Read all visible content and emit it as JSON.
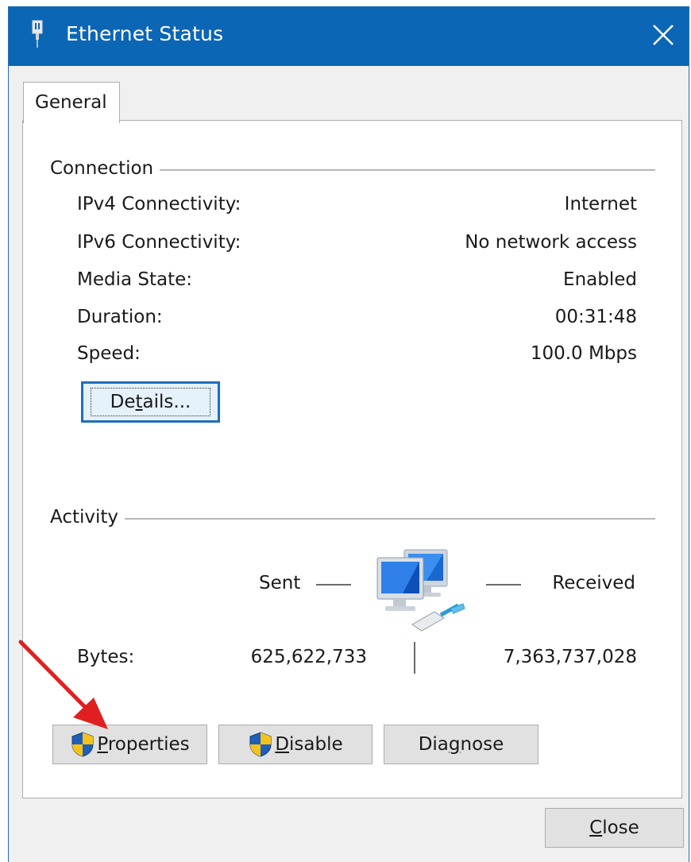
{
  "window": {
    "title": "Ethernet Status",
    "close_symbol": "✕"
  },
  "tabs": [
    {
      "label": "General",
      "selected": true
    }
  ],
  "connection": {
    "group_label": "Connection",
    "rows": [
      {
        "label": "IPv4 Connectivity:",
        "value": "Internet"
      },
      {
        "label": "IPv6 Connectivity:",
        "value": "No network access"
      },
      {
        "label": "Media State:",
        "value": "Enabled"
      },
      {
        "label": "Duration:",
        "value": "00:31:48"
      },
      {
        "label": "Speed:",
        "value": "100.0 Mbps"
      }
    ],
    "details_button": {
      "before": "De",
      "accel": "t",
      "after": "ails..."
    }
  },
  "activity": {
    "group_label": "Activity",
    "sent_label": "Sent",
    "received_label": "Received",
    "bytes_label": "Bytes:",
    "bytes_sent": "625,622,733",
    "bytes_received": "7,363,737,028"
  },
  "buttons": {
    "properties": {
      "accel": "P",
      "rest": "roperties"
    },
    "disable": {
      "accel": "D",
      "rest": "isable"
    },
    "diagnose": {
      "before": "Dia",
      "accel": "g",
      "after": "nose"
    },
    "close": {
      "accel": "C",
      "rest": "lose"
    }
  },
  "colors": {
    "titlebar": "#0b66b5",
    "focus_border": "#1f6fb8",
    "annotation_arrow": "#e02020"
  },
  "icons": {
    "title": "network-adapter-icon",
    "activity": "network-computers-icon",
    "uac": "uac-shield-icon",
    "annotation": "red-arrow-annotation"
  }
}
